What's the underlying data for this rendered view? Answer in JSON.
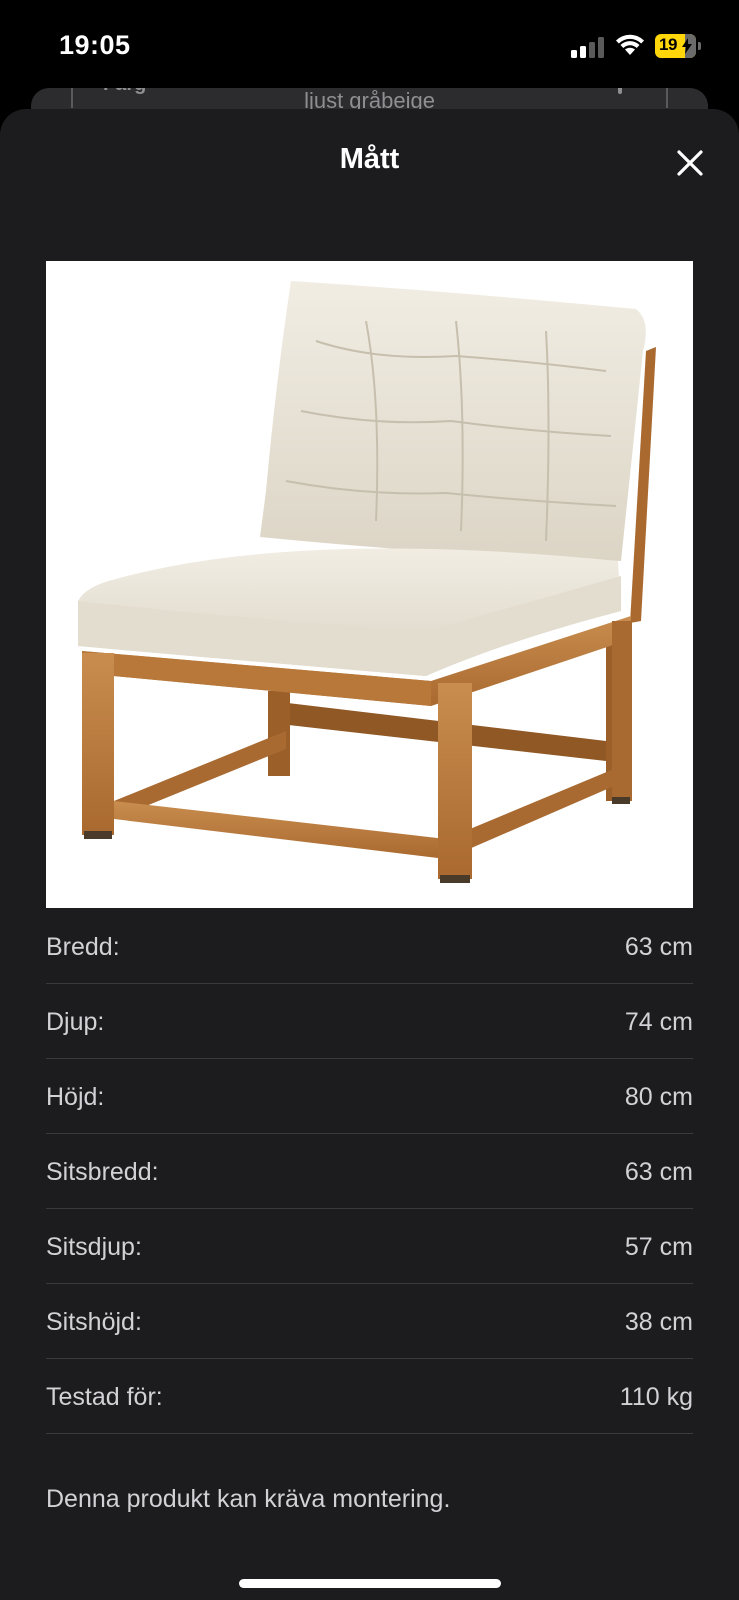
{
  "status_bar": {
    "time": "19:05",
    "battery": "19",
    "icons": [
      "cellular-signal-icon",
      "wifi-icon",
      "battery-charging-icon"
    ]
  },
  "background_page": {
    "field_label": "Färg",
    "field_value": "ljust gråbeige"
  },
  "sheet": {
    "title": "Mått",
    "close_icon": "close-icon",
    "image_alt": "chair-with-cushions"
  },
  "dimensions": [
    {
      "label": "Bredd:",
      "value": "63 cm"
    },
    {
      "label": "Djup:",
      "value": "74 cm"
    },
    {
      "label": "Höjd:",
      "value": "80 cm"
    },
    {
      "label": "Sitsbredd:",
      "value": "63 cm"
    },
    {
      "label": "Sitsdjup:",
      "value": "57 cm"
    },
    {
      "label": "Sitshöjd:",
      "value": "38 cm"
    },
    {
      "label": "Testad för:",
      "value": "110 kg"
    }
  ],
  "assembly_note": "Denna produkt kan kräva montering.",
  "colors": {
    "sheet_background": "#1c1c1e",
    "text_primary": "#ffffff",
    "text_secondary": "#d1d1d6",
    "divider": "#3a3a3c",
    "battery": "#ffd60a",
    "wood": "#b9773a",
    "cushion": "#ece7dc"
  }
}
